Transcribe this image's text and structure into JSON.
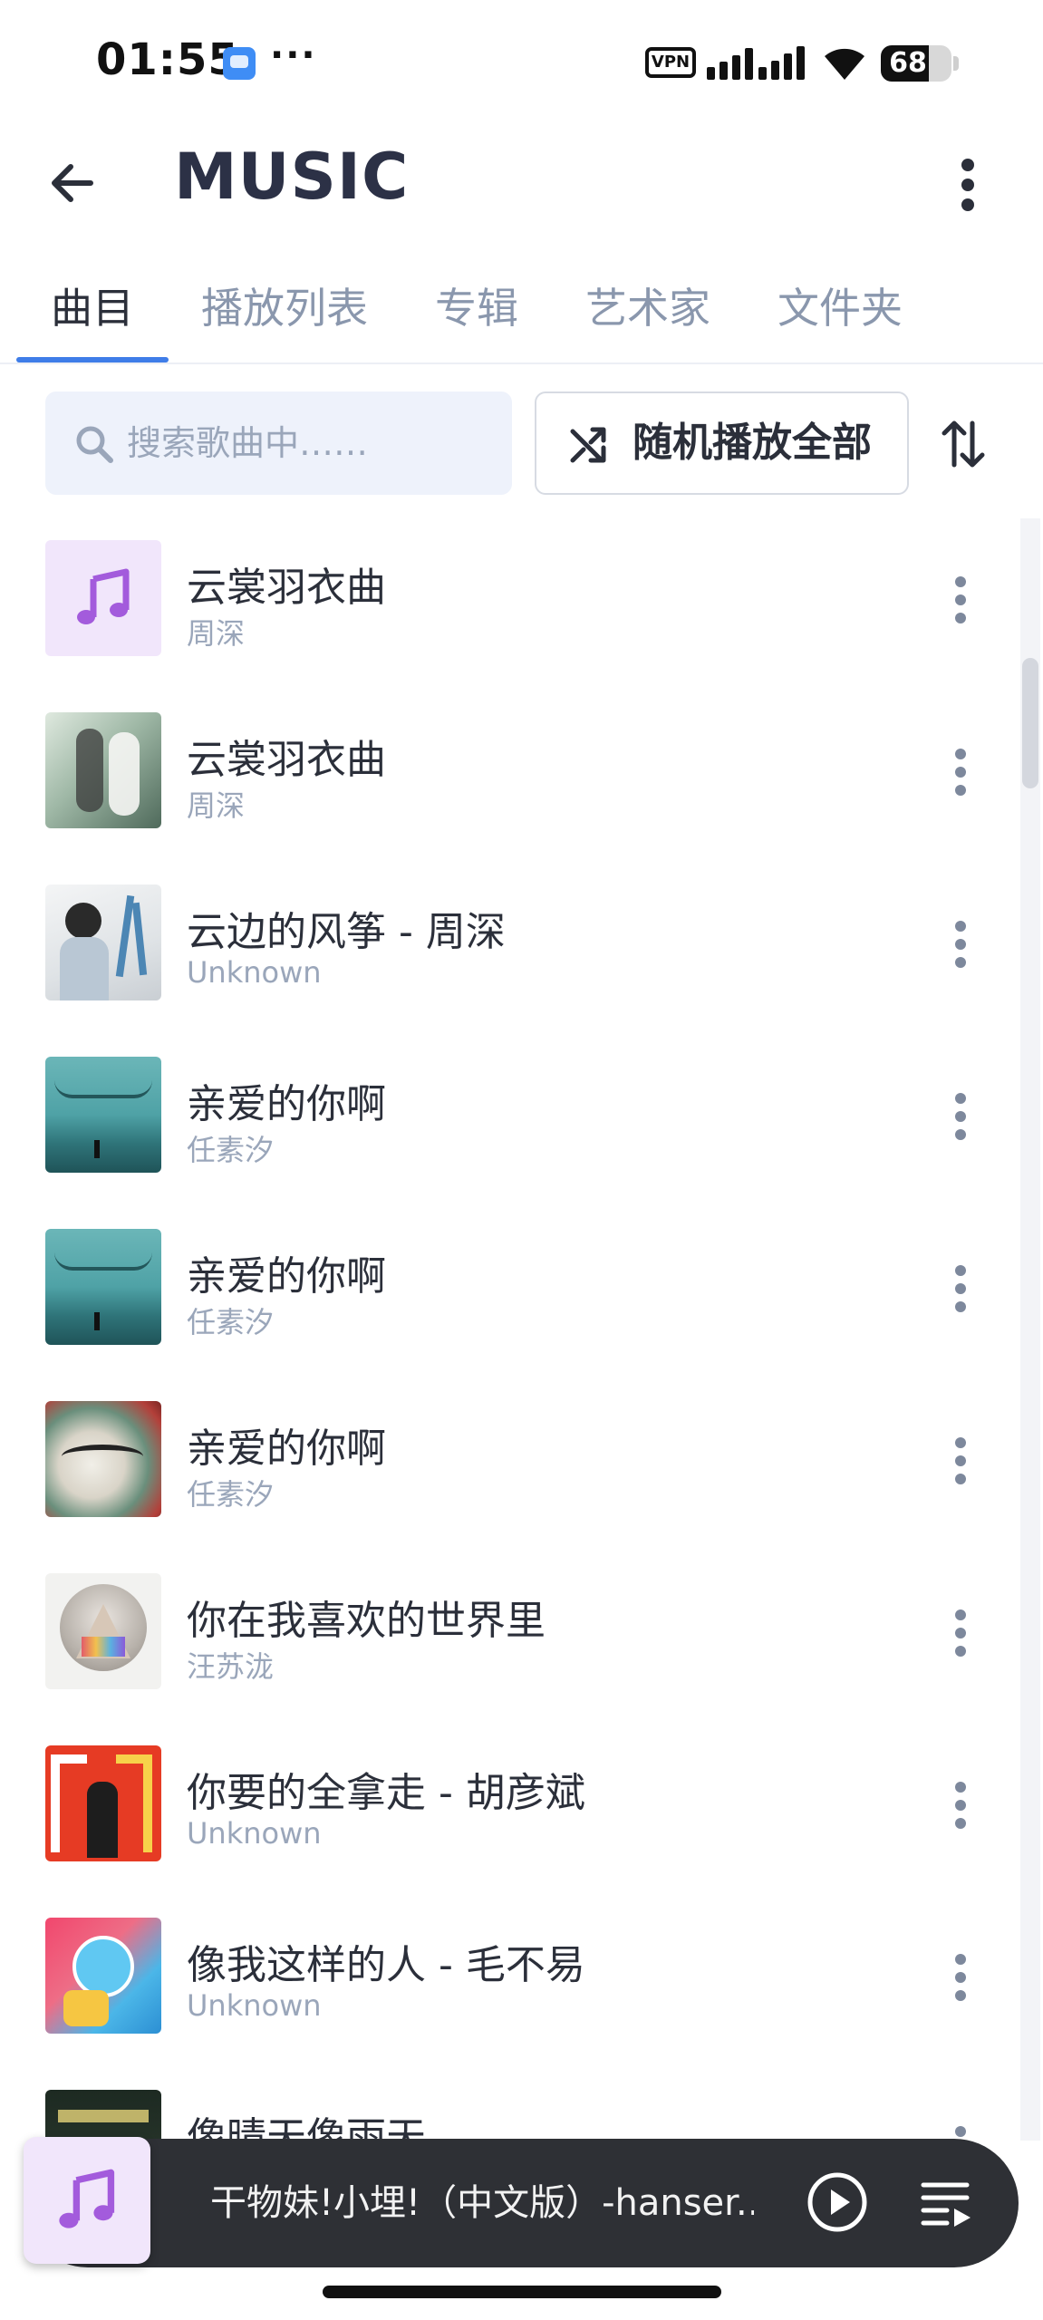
{
  "status_bar": {
    "time": "01:55",
    "dots": "···",
    "vpn": "VPN",
    "battery_level": "68",
    "battery_fraction": 0.68
  },
  "app_bar": {
    "title": "MUSIC",
    "back_icon": "arrow-left-icon",
    "menu_icon": "more-vertical-icon"
  },
  "tabs": [
    {
      "label": "曲目",
      "active": true
    },
    {
      "label": "播放列表",
      "active": false
    },
    {
      "label": "专辑",
      "active": false
    },
    {
      "label": "艺术家",
      "active": false
    },
    {
      "label": "文件夹",
      "active": false
    }
  ],
  "toolbar": {
    "search_placeholder": "搜索歌曲中……",
    "shuffle_label": "随机播放全部",
    "shuffle_icon": "shuffle-icon",
    "sort_icon": "sort-arrows-icon"
  },
  "songs": [
    {
      "title": "云裳羽衣曲",
      "artist": "周深",
      "art": "music-note-placeholder"
    },
    {
      "title": "云裳羽衣曲",
      "artist": "周深",
      "art": "cover-couple-green"
    },
    {
      "title": "云边的风筝 - 周深",
      "artist": "Unknown",
      "art": "cover-boy-light"
    },
    {
      "title": "亲爱的你啊",
      "artist": "任素汐",
      "art": "cover-sea-teal"
    },
    {
      "title": "亲爱的你啊",
      "artist": "任素汐",
      "art": "cover-sea-teal"
    },
    {
      "title": "亲爱的你啊",
      "artist": "任素汐",
      "art": "cover-ink-red"
    },
    {
      "title": "你在我喜欢的世界里",
      "artist": "汪苏泷",
      "art": "cover-mountain-circle"
    },
    {
      "title": "你要的全拿走 - 胡彦斌",
      "artist": "Unknown",
      "art": "cover-red-poster"
    },
    {
      "title": "像我这样的人 - 毛不易",
      "artist": "Unknown",
      "art": "cover-blue-fox"
    },
    {
      "title": "像晴天像雨天",
      "artist": "",
      "art": "cover-dark-green"
    }
  ],
  "mini_player": {
    "title": "干物妹!小埋!（中文版）-hanser.‥",
    "art": "music-note-placeholder",
    "play_icon": "play-circle-icon",
    "queue_icon": "queue-music-icon"
  },
  "colors": {
    "accent": "#3f7de8",
    "title_text": "#2c3146",
    "secondary_text": "#9aa6ba",
    "note_purple": "#a35bdc",
    "note_bg": "#f1e6fb",
    "player_bg": "#2e3035"
  }
}
